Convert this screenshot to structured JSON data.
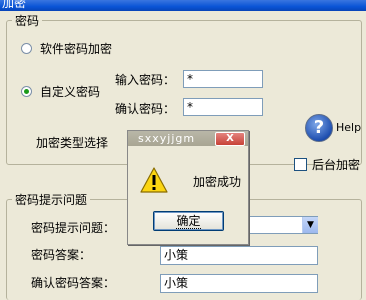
{
  "window": {
    "title": "加密"
  },
  "password_group": {
    "title": "密码",
    "radio_software_label": "软件密码加密",
    "radio_custom_label": "自定义密码",
    "enter_password_label": "输入密码：",
    "enter_password_value": "*",
    "confirm_password_label": "确认密码：",
    "confirm_password_value": "*",
    "encryption_type_label": "加密类型选择"
  },
  "help": {
    "label": "Help"
  },
  "background_encrypt": {
    "label": "后台加密",
    "checked": false
  },
  "hint_group": {
    "title": "密码提示问题",
    "question_label": "密码提示问题：",
    "answer_label": "密码答案：",
    "answer_value": "小策",
    "confirm_answer_label": "确认密码答案：",
    "confirm_answer_value": "小策"
  },
  "dialog": {
    "title": "sxxyjjgm",
    "message": "加密成功",
    "ok_label": "确定",
    "close_glyph": "X"
  }
}
